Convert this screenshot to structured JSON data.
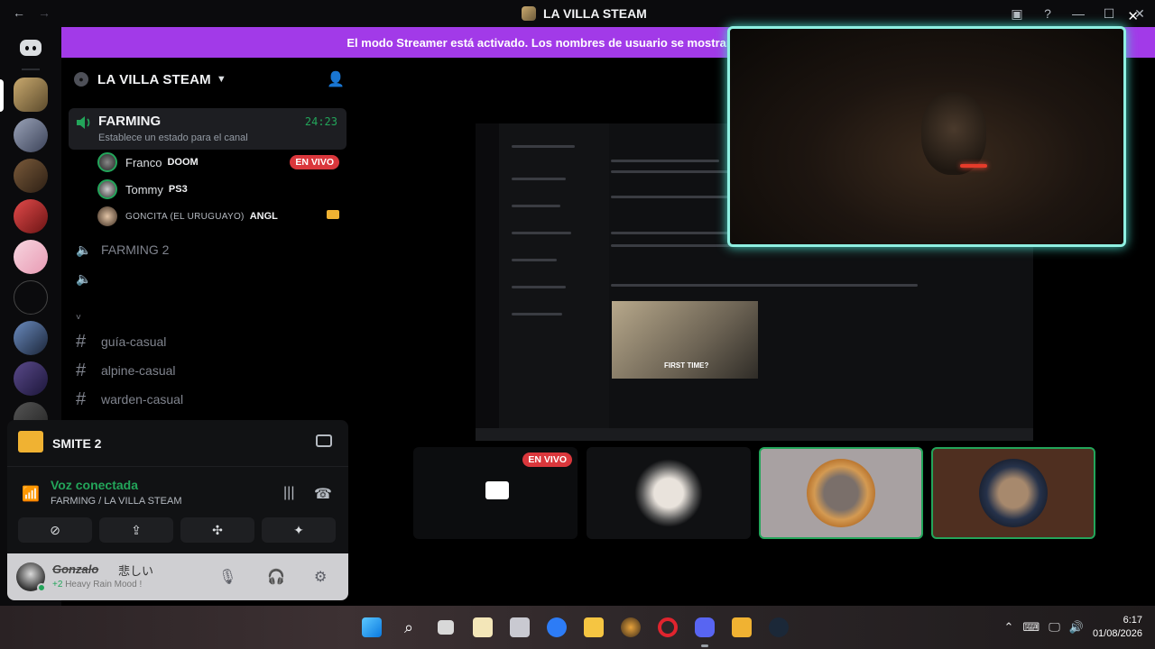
{
  "window": {
    "title": "LA VILLA STEAM",
    "back": "←",
    "forward": "→",
    "minimize": "—",
    "maximize": "☐",
    "close": "✕"
  },
  "banner": {
    "text": "El modo Streamer está activado. Los nombres de usuario se mostrarán de forma",
    "close": "✕"
  },
  "server": {
    "name": "LA VILLA STEAM"
  },
  "active_channel": {
    "name": "FARMING",
    "timer": "24:23",
    "status_placeholder": "Establece un estado para el canal",
    "users": [
      {
        "name": "Franco",
        "activity": "DOOM",
        "badge": "EN VIVO"
      },
      {
        "name": "Tommy",
        "activity": "PS3"
      },
      {
        "name": "GONCITA (EL URUGUAYO)",
        "activity": "ANGL"
      }
    ]
  },
  "channels": [
    {
      "type": "voice",
      "name": "FARMING 2"
    },
    {
      "type": "voice",
      "name": ""
    },
    {
      "type": "category",
      "name": "˅"
    },
    {
      "type": "text",
      "name": "guía-casual"
    },
    {
      "type": "text",
      "name": "alpine-casual"
    },
    {
      "type": "text",
      "name": "warden-casual"
    }
  ],
  "game_activity": {
    "name": "SMITE 2"
  },
  "voice_status": {
    "title": "Voz conectada",
    "subtitle": "FARMING / LA VILLA STEAM"
  },
  "user": {
    "name": "Gonzalo",
    "suffix": "悲しい",
    "status": "Heavy Rain Mood !",
    "extra": "+2"
  },
  "stream_tiles": [
    {
      "badge": "EN VIVO"
    }
  ],
  "screenshare": {
    "caption": "FIRST TIME?"
  },
  "clock": {
    "time": "6:17",
    "date": "01/08/2026"
  },
  "colors": {
    "accent": "#a23ae8",
    "online": "#23a55a",
    "live": "#da373c",
    "highlight": "#8ff0e2"
  }
}
